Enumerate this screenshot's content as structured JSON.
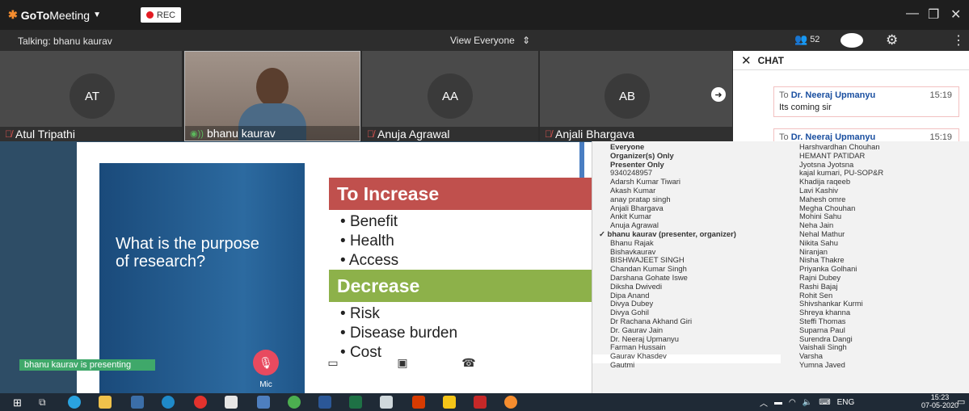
{
  "app": {
    "brand_bold": "GoTo",
    "brand_light": "Meeting",
    "rec_label": "REC"
  },
  "infobar": {
    "talking": "Talking: bhanu kaurav",
    "view": "View Everyone",
    "attendee_count": "52"
  },
  "tiles": [
    {
      "initials": "AT",
      "name": "Atul Tripathi"
    },
    {
      "initials": "",
      "name": "bhanu kaurav"
    },
    {
      "initials": "AA",
      "name": "Anuja Agrawal"
    },
    {
      "initials": "AB",
      "name": "Anjali Bhargava"
    }
  ],
  "chat": {
    "title": "CHAT",
    "messages": [
      {
        "to_prefix": "To",
        "to": "Dr. Neeraj Upmanyu",
        "time": "15:19",
        "text": "Its coming sir"
      },
      {
        "to_prefix": "To",
        "to": "Dr. Neeraj Upmanyu",
        "time": "15:19",
        "text": ""
      }
    ]
  },
  "slide": {
    "title": "What is the purpose of research?",
    "increase": "To Increase",
    "increase_items": [
      "Benefit",
      "Health",
      "Access"
    ],
    "decrease": "Decrease",
    "decrease_items": [
      "Risk",
      "Disease burden",
      "Cost"
    ]
  },
  "presenting_banner": "bhanu kaurav is presenting",
  "controls": {
    "mic": "Mic",
    "camera": "Camera",
    "screen": "Screen",
    "leave": "Leave"
  },
  "recipients": {
    "col1": [
      "Everyone",
      "Organizer(s) Only",
      "Presenter Only",
      "9340248957",
      "Adarsh Kumar Tiwari",
      "Akash Kumar",
      "anay pratap singh",
      "Anjali Bhargava",
      "Ankit Kumar",
      "Anuja Agrawal",
      "bhanu kaurav (presenter, organizer)",
      "Bhanu Rajak",
      "Bishavkaurav",
      "BISHWAJEET SINGH",
      "Chandan Kumar Singh",
      "Darshana Gohate Iswe",
      "Diksha Dwivedi",
      "Dipa Anand",
      "Divya Dubey",
      "Divya Gohil",
      "Dr Rachana Akhand Giri",
      "Dr. Gaurav Jain",
      "Dr. Neeraj Upmanyu",
      "Farman Hussain",
      "Gaurav Khasdev",
      "Gautmi"
    ],
    "col2": [
      "Harshvardhan Chouhan",
      "HEMANT PATIDAR",
      "Jyotsna Jyotsna",
      "kajal kumari, PU-SOP&R",
      "Khadija raqeeb",
      "Lavi Kashiv",
      "Mahesh omre",
      "Megha Chouhan",
      "Mohini Sahu",
      "Neha Jain",
      "Nehal Mathur",
      "Nikita Sahu",
      "Niranjan",
      "Nisha Thakre",
      "Priyanka Golhani",
      "Rajni Dubey",
      "Rashi Bajaj",
      "Rohit Sen",
      "Shivshankar Kurmi",
      "Shreya khanna",
      "Steffi Thomas",
      "Suparna Paul",
      "Surendra Dangi",
      "Vaishali Singh",
      "Varsha",
      "Yumna Javed"
    ]
  },
  "taskbar": {
    "lang": "ENG",
    "time": "15:23",
    "date": "07-05-2020"
  },
  "colors": {
    "increase": "#c0504d",
    "decrease": "#8db14a",
    "brand": "#f68d2e",
    "rec": "#e31b23"
  }
}
